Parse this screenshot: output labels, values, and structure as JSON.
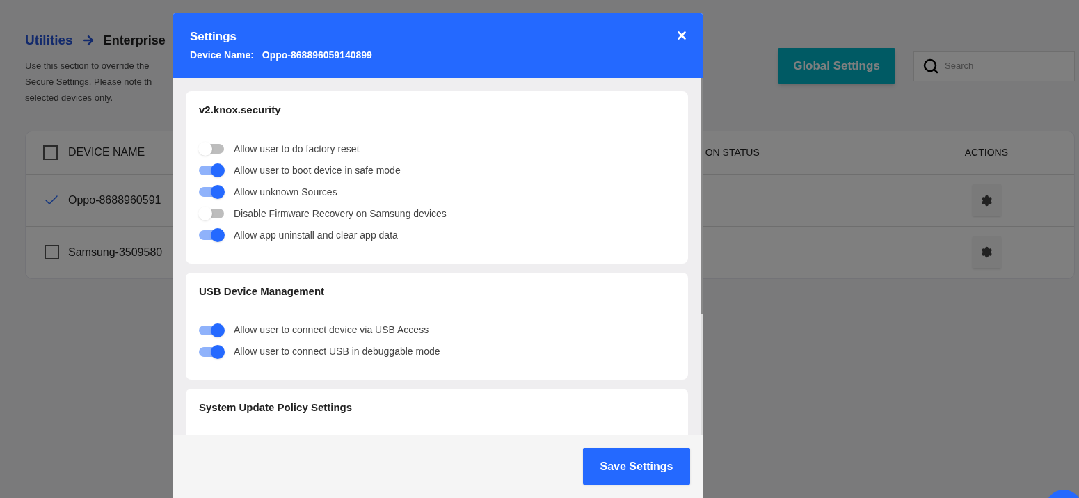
{
  "breadcrumb": {
    "parent": "Utilities",
    "current": "Enterprise"
  },
  "description_lines": [
    "Use this section to override the",
    "Secure Settings. Please note th",
    "selected devices only."
  ],
  "global_settings_button": "Global Settings",
  "search": {
    "placeholder": "Search"
  },
  "table": {
    "select_all_checked": false,
    "columns": [
      "DEVICE NAME",
      "ON STATUS",
      "ACTIONS"
    ],
    "rows": [
      {
        "device_name": "Oppo-8688960591",
        "checked": true
      },
      {
        "device_name": "Samsung-3509580",
        "checked": false
      }
    ]
  },
  "modal": {
    "title": "Settings",
    "device_label": "Device Name:",
    "device_name": "Oppo-868896059140899",
    "sections": [
      {
        "title": "v2.knox.security",
        "items": [
          {
            "kind": "toggle",
            "label": "Allow user to do factory reset",
            "on": false
          },
          {
            "kind": "toggle",
            "label": "Allow user to boot device in safe mode",
            "on": true
          },
          {
            "kind": "toggle",
            "label": "Allow unknown Sources",
            "on": true
          },
          {
            "kind": "toggle",
            "label": "Disable Firmware Recovery on Samsung devices",
            "on": false
          },
          {
            "kind": "toggle",
            "label": "Allow app uninstall and clear app data",
            "on": true
          }
        ]
      },
      {
        "title": "USB Device Management",
        "items": [
          {
            "kind": "toggle",
            "label": "Allow user to connect device via USB Access",
            "on": true
          },
          {
            "kind": "toggle",
            "label": "Allow user to connect USB in debuggable mode",
            "on": true
          }
        ]
      },
      {
        "title": "System Update Policy Settings"
      }
    ],
    "save_button": "Save Settings"
  }
}
